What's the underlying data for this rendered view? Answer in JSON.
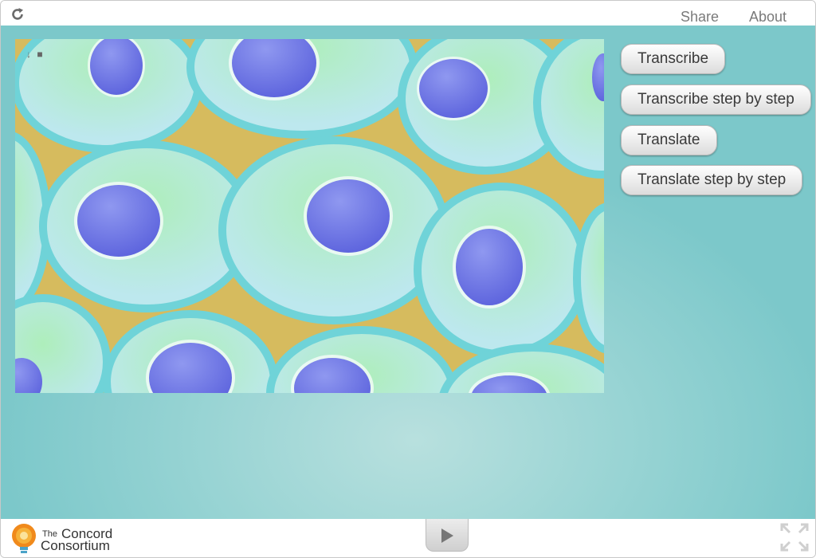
{
  "topbar": {
    "share": "Share",
    "about": "About"
  },
  "controls": {
    "transcribe": "Transcribe",
    "transcribe_step": "Transcribe step by step",
    "translate": "Translate",
    "translate_step": "Translate step by step"
  },
  "footer": {
    "logo_the": "The",
    "logo_concord": "Concord",
    "logo_consortium": "Consortium"
  },
  "colors": {
    "background": "#8ccfcf",
    "membrane": "#6fd3d8",
    "cytoplasm": "#b8e8ec",
    "nucleus": "#6f78e0",
    "extracellular": "#d9c063"
  },
  "icons": [
    "reload-icon",
    "download-icon",
    "lock-icon",
    "play-icon",
    "fullscreen-icon",
    "lightbulb-logo-icon"
  ]
}
